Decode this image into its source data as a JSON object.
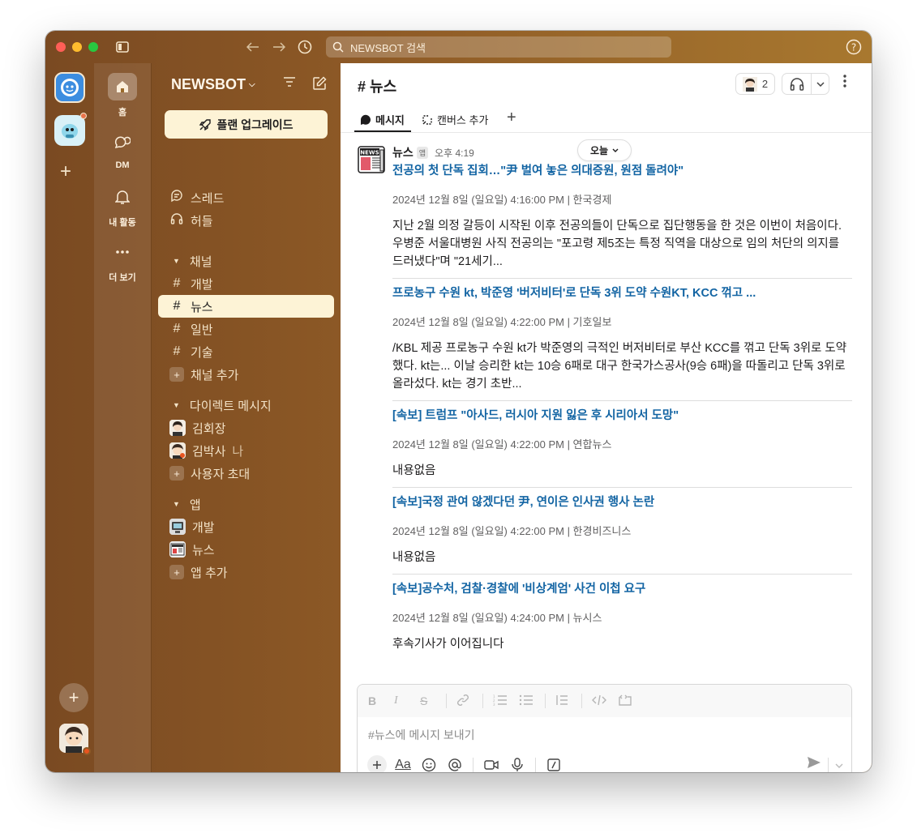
{
  "search": {
    "placeholder": "NEWSBOT 검색"
  },
  "nav": {
    "home": "홈",
    "dm": "DM",
    "activity": "내 활동",
    "more": "더 보기"
  },
  "sidebar": {
    "workspace": "NEWSBOT",
    "upgrade": "플랜 업그레이드",
    "threads": "스레드",
    "huddles": "허들",
    "channels_header": "채널",
    "channels": [
      "개발",
      "뉴스",
      "일반",
      "기술"
    ],
    "add_channel": "채널 추가",
    "dm_header": "다이렉트 메시지",
    "dms": [
      "김회장",
      "김박사"
    ],
    "you_label": "나",
    "invite": "사용자 초대",
    "apps_header": "앱",
    "apps": [
      "개발",
      "뉴스"
    ],
    "add_app": "앱 추가"
  },
  "channel": {
    "title": "# 뉴스",
    "member_count": "2",
    "tab_messages": "메시지",
    "tab_canvas": "캔버스 추가"
  },
  "message": {
    "sender": "뉴스",
    "app_badge": "앱",
    "time": "오후 4:19",
    "date_pill": "오늘",
    "articles": [
      {
        "title": "전공의 첫 단독 집회…\"尹 벌여 놓은 의대증원, 원점 돌려야\"",
        "meta": "2024년 12월 8일 (일요일) 4:16:00 PM | 한국경제",
        "body": "지난 2월 의정 갈등이 시작된 이후 전공의들이 단독으로 집단행동을 한 것은 이번이 처음이다. 우병준 서울대병원 사직 전공의는 \"포고령 제5조는 특정 직역을 대상으로 임의 처단의 의지를 드러냈다\"며 \"21세기..."
      },
      {
        "title": "프로농구 수원 kt, 박준영 '버저비터'로 단독 3위 도약 수원KT, KCC 꺾고 ...",
        "meta": "2024년 12월 8일 (일요일) 4:22:00 PM | 기호일보",
        "body": "/KBL 제공 프로농구 수원 kt가 박준영의 극적인 버저비터로 부산 KCC를 꺾고 단독 3위로 도약했다. kt는... 이날 승리한 kt는 10승 6패로 대구 한국가스공사(9승 6패)을 따돌리고 단독 3위로 올라섰다. kt는 경기 초반..."
      },
      {
        "title": "[속보] 트럼프 \"아사드, 러시아 지원 잃은 후 시리아서 도망\"",
        "meta": "2024년 12월 8일 (일요일) 4:22:00 PM | 연합뉴스",
        "body": "내용없음"
      },
      {
        "title": "[속보]국정 관여 않겠다던 尹, 연이은 인사권 행사 논란",
        "meta": "2024년 12월 8일 (일요일) 4:22:00 PM | 한경비즈니스",
        "body": "내용없음"
      },
      {
        "title": "[속보]공수처, 검찰·경찰에 '비상계엄' 사건 이첩 요구",
        "meta": "2024년 12월 8일 (일요일) 4:24:00 PM | 뉴시스",
        "body": "후속기사가 이어집니다"
      }
    ]
  },
  "composer": {
    "placeholder": "#뉴스에 메시지 보내기",
    "font_label": "Aa"
  },
  "colors": {
    "sidebar_gradient_start": "#7a4a22",
    "sidebar_gradient_end": "#a8782f",
    "active_item": "#fdf3d6",
    "link": "#1264a3"
  }
}
